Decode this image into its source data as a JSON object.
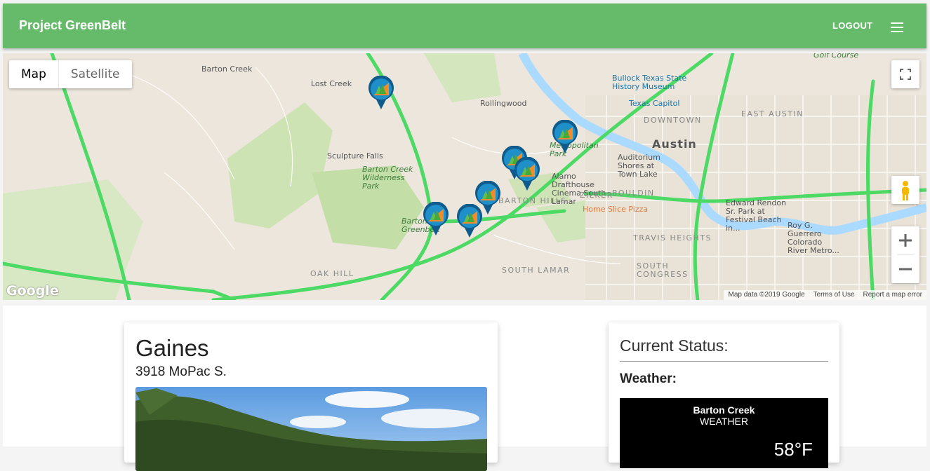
{
  "app": {
    "title": "Project GreenBelt",
    "logout_label": "LOGOUT",
    "menu_icon": "hamburger-menu-icon"
  },
  "map": {
    "type_control": {
      "map_label": "Map",
      "satellite_label": "Satellite",
      "selected": "Map"
    },
    "labels": {
      "barton_creek": "Barton Creek",
      "lost_creek": "Lost Creek",
      "rollingwood": "Rollingwood",
      "sculpture_falls": "Sculpture Falls",
      "bc_wilderness": "Barton Creek Wilderness Park",
      "austin": "Austin",
      "downtown": "DOWNTOWN",
      "east_austin": "EAST AUSTIN",
      "bullock": "Bullock Texas State History Museum",
      "capitol": "Texas Capitol",
      "auditorium": "Auditorium Shores at Town Lake",
      "alamo": "Alamo Drafthouse Cinema South Lamar",
      "zilker": "ZILKER",
      "bouldin": "BOULDIN",
      "home_slice": "Home Slice Pizza",
      "barton_hills": "BARTON HILLS",
      "edward_rendon": "Edward Rendon Sr. Park at Festival Beach in...",
      "roy_guerrero": "Roy G. Guerrero Colorado River Metro...",
      "travis_heights": "TRAVIS HEIGHTS",
      "south_lamar": "SOUTH LAMAR",
      "south_congress": "SOUTH CONGRESS",
      "oak_hill": "OAK HILL",
      "metropolitan": "Metropolitan Park",
      "barton_greenbelt": "Barton Greenbelt",
      "golf_course": "Golf Course"
    },
    "attribution": {
      "data": "Map data ©2019 Google",
      "terms": "Terms of Use",
      "report": "Report a map error"
    },
    "logo": "Google",
    "marker_icon": "greenbelt-trailhead-marker-icon",
    "accent": "#66bb6a"
  },
  "site": {
    "name": "Gaines",
    "address": "3918 MoPac S."
  },
  "status": {
    "title": "Current Status:",
    "weather_label": "Weather:",
    "widget": {
      "location": "Barton Creek",
      "subtitle": "WEATHER",
      "temp": "58°F"
    }
  }
}
